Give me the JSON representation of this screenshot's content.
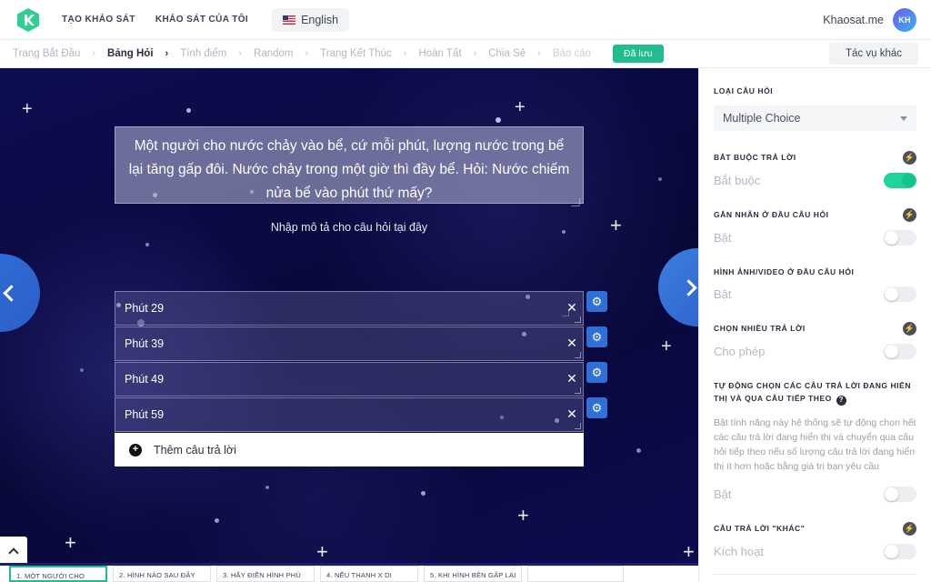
{
  "topnav": {
    "logo_alt": "khaosat-logo",
    "links": [
      {
        "label": "TẠO KHẢO SÁT"
      },
      {
        "label": "KHẢO SÁT CỦA TÔI"
      }
    ],
    "language": "English",
    "account_name": "Khaosat.me",
    "avatar_initials": "KH"
  },
  "breadcrumb": {
    "items": [
      {
        "label": "Trang Bắt Đầu",
        "state": "inactive"
      },
      {
        "label": "Bảng Hỏi",
        "state": "active"
      },
      {
        "label": "Tính điểm",
        "state": "inactive"
      },
      {
        "label": "Random",
        "state": "inactive"
      },
      {
        "label": "Trang Kết Thúc",
        "state": "inactive"
      },
      {
        "label": "Hoàn Tất",
        "state": "inactive"
      },
      {
        "label": "Chia Sẻ",
        "state": "inactive"
      },
      {
        "label": "Báo cáo",
        "state": "disabled"
      }
    ],
    "saved_badge": "Đã lưu",
    "more_actions": "Tác vụ khác",
    "saved_color": "#22bd8e"
  },
  "stage": {
    "question_text": "Một người cho nước chảy vào bể, cứ mỗi phút, lượng nước trong bể lại tăng gấp đôi. Nước chảy trong một giờ thì đầy bể. Hỏi: Nước chiếm nửa bể vào phút thứ mấy?",
    "description_placeholder": "Nhập mô tả cho câu hỏi tại đây",
    "prev_label": "‹",
    "next_label": "›",
    "answers": [
      {
        "value": "Phút 29"
      },
      {
        "value": "Phút 39"
      },
      {
        "value": "Phút 49"
      },
      {
        "value": "Phút 59"
      }
    ],
    "add_answer_label": "Thêm câu trả lời",
    "remove_icon": "✕",
    "gear_icon": "⚙"
  },
  "panel": {
    "question_type": {
      "label": "LOẠI CÂU HỎI",
      "value": "Multiple Choice"
    },
    "sections": [
      {
        "label": "BẮT BUỘC TRẢ LỜI",
        "state_text": "Bắt buộc",
        "toggle": "on"
      },
      {
        "label": "GẮN NHÃN Ở ĐẦU CÂU HỎI",
        "state_text": "Bật",
        "toggle": "off"
      },
      {
        "label": "HÌNH ẢNH/VIDEO Ở ĐẦU CÂU HỎI",
        "state_text": "Bật",
        "toggle": "off"
      },
      {
        "label": "CHỌN NHIỀU TRẢ LỜI",
        "state_text": "Cho phép",
        "toggle": "off"
      }
    ],
    "auto_select": {
      "label": "TỰ ĐỘNG CHỌN CÁC CÂU TRẢ LỜI ĐANG HIỂN THỊ VÀ QUA CÂU TIẾP THEO",
      "help_glyph": "?",
      "description": "Bật tính năng này hệ thống sẽ tự động chọn hết các câu trả lời đang hiển thị và chuyển qua câu hỏi tiếp theo nếu số lượng câu trả lời đang hiển thị ít hơn hoặc bằng giá trị bạn yêu cầu",
      "state_text": "Bật",
      "toggle": "off"
    },
    "other_answer": {
      "label": "CÂU TRẢ LỜI \"KHÁC\"",
      "state_text": "Kích hoạt",
      "toggle": "off"
    },
    "bolt_glyph": "⚡",
    "accent_on_color": "#1fd39a"
  },
  "question_strip": {
    "items": [
      {
        "label": "1. MỘT NGƯỜI CHO",
        "selected": true
      },
      {
        "label": "2. HÌNH NÀO SAU ĐÂY",
        "selected": false
      },
      {
        "label": "3. HÃY ĐIỀN HÌNH PHÙ",
        "selected": false
      },
      {
        "label": "4. NẾU THANH X DI",
        "selected": false
      },
      {
        "label": "5. KHI HÌNH BÊN GẶP LẠI",
        "selected": false
      },
      {
        "label": "",
        "selected": false
      }
    ]
  }
}
